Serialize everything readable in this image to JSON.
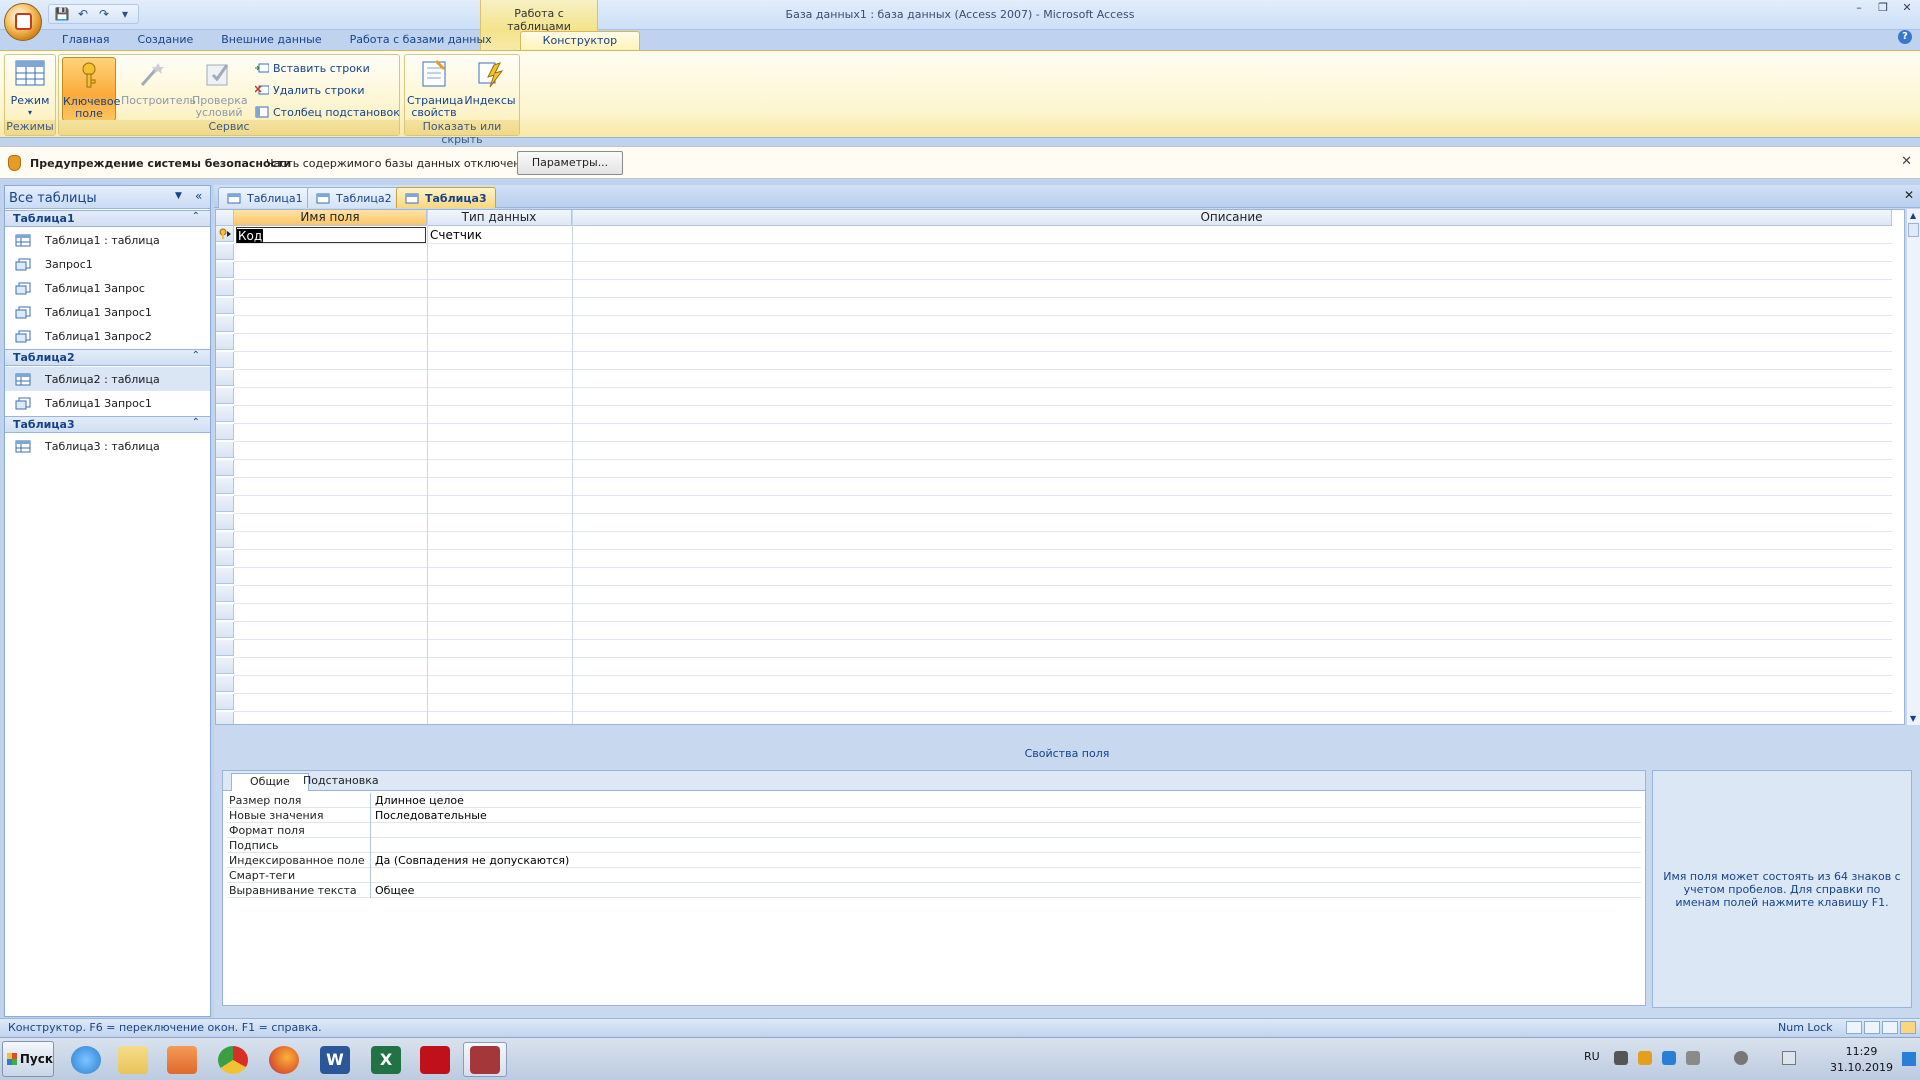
{
  "window": {
    "title": "База данных1 : база данных (Access 2007) - Microsoft Access",
    "contextual_group": "Работа с таблицами",
    "minimize": "–",
    "restore": "❐",
    "close": "✕",
    "help": "?"
  },
  "qat": {
    "save": "💾",
    "undo": "↶",
    "redo": "↷",
    "customize": "▾"
  },
  "tabs": [
    {
      "label": "Главная"
    },
    {
      "label": "Создание"
    },
    {
      "label": "Внешние данные"
    },
    {
      "label": "Работа с базами данных"
    },
    {
      "label": "Конструктор"
    }
  ],
  "ribbon": {
    "groups": [
      {
        "label": "Режимы"
      },
      {
        "label": "Сервис"
      },
      {
        "label": "Показать или скрыть"
      }
    ],
    "mode_button": {
      "line1": "Режим",
      "line2": "▾"
    },
    "key_button": {
      "line1": "Ключевое",
      "line2": "поле"
    },
    "builder_button": {
      "line1": "Построитель",
      "line2": ""
    },
    "test_button": {
      "line1": "Проверка",
      "line2": "условий"
    },
    "insert_rows": "Вставить строки",
    "delete_rows": "Удалить строки",
    "lookup_column": "Столбец  подстановок",
    "property_sheet": {
      "line1": "Страница",
      "line2": "свойств"
    },
    "indexes": {
      "line1": "Индексы",
      "line2": ""
    }
  },
  "security": {
    "title": "Предупреждение системы безопасности",
    "message": "Часть содержимого базы данных отключено",
    "button": "Параметры...",
    "close": "✕"
  },
  "nav": {
    "header": "Все таблицы",
    "dropdown": "▼",
    "collapse": "«",
    "groups": [
      {
        "label": "Таблица1",
        "chev": "⌃",
        "items": [
          {
            "label": "Таблица1 : таблица"
          },
          {
            "label": "Запрос1"
          },
          {
            "label": "Таблица1 Запрос"
          },
          {
            "label": "Таблица1 Запрос1"
          },
          {
            "label": "Таблица1 Запрос2"
          }
        ]
      },
      {
        "label": "Таблица2",
        "chev": "⌃",
        "items": [
          {
            "label": "Таблица2 : таблица"
          },
          {
            "label": "Таблица1 Запрос1"
          }
        ]
      },
      {
        "label": "Таблица3",
        "chev": "⌃",
        "items": [
          {
            "label": "Таблица3 : таблица"
          }
        ]
      }
    ]
  },
  "doc_tabs": [
    {
      "label": "Таблица1"
    },
    {
      "label": "Таблица2"
    },
    {
      "label": "Таблица3"
    }
  ],
  "doc_close": "✕",
  "grid": {
    "headers": [
      "Имя поля",
      "Тип данных",
      "Описание"
    ],
    "rows": [
      {
        "name": "Код",
        "type": "Счетчик",
        "description": ""
      }
    ]
  },
  "field_props": {
    "label": "Свойства поля",
    "tabs": [
      "Общие",
      "Подстановка"
    ],
    "rows": [
      {
        "label": "Размер поля",
        "value": "Длинное целое"
      },
      {
        "label": "Новые значения",
        "value": "Последовательные"
      },
      {
        "label": "Формат поля",
        "value": ""
      },
      {
        "label": "Подпись",
        "value": ""
      },
      {
        "label": "Индексированное поле",
        "value": "Да (Совпадения не допускаются)"
      },
      {
        "label": "Смарт-теги",
        "value": ""
      },
      {
        "label": "Выравнивание текста",
        "value": "Общее"
      }
    ],
    "help": "Имя поля может состоять из 64 знаков с учетом пробелов. Для справки по именам полей нажмите клавишу F1."
  },
  "status": {
    "message": "Конструктор.  F6 = переключение окон.  F1 = справка.",
    "numlock": "Num Lock"
  },
  "taskbar": {
    "start": "Пуск",
    "lang": "RU",
    "time": "11:29",
    "date": "31.10.2019",
    "apps": [
      {
        "name": "internet-explorer",
        "color": "#2a7fd4"
      },
      {
        "name": "file-explorer",
        "color": "#e8c45a"
      },
      {
        "name": "media-player",
        "color": "#e06a2a"
      },
      {
        "name": "chrome",
        "color": "#3a9e45"
      },
      {
        "name": "firefox",
        "color": "#e2602a"
      },
      {
        "name": "word",
        "color": "#2b579a"
      },
      {
        "name": "excel",
        "color": "#217346"
      },
      {
        "name": "acrobat",
        "color": "#c0111a"
      },
      {
        "name": "access",
        "color": "#a4373a"
      }
    ]
  }
}
